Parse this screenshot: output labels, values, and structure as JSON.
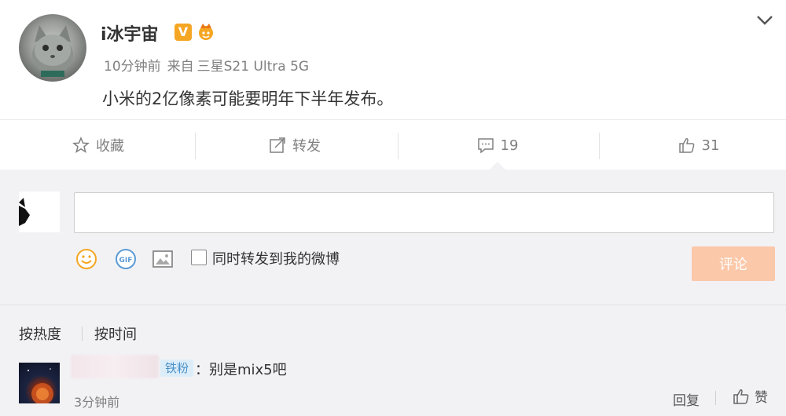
{
  "post": {
    "username": "i冰宇宙",
    "vip_badge": "V",
    "time": "10分钟前",
    "source_prefix": "来自",
    "source": "三星S21 Ultra 5G",
    "text": "小米的2亿像素可能要明年下半年发布。"
  },
  "actions": {
    "favorite_label": "收藏",
    "repost_label": "转发",
    "comment_count": "19",
    "like_count": "31"
  },
  "composer": {
    "input_value": "",
    "repost_checkbox_label": "同时转发到我的微博",
    "submit_label": "评论",
    "gif_label": "GIF"
  },
  "sort": {
    "hot_label": "按热度",
    "time_label": "按时间"
  },
  "comments": [
    {
      "badge": "铁粉",
      "text": "：别是mix5吧",
      "time": "3分钟前",
      "reply_label": "回复",
      "like_label": "赞"
    }
  ],
  "colors": {
    "accent_orange": "#fbc8a9",
    "badge_gold": "#f5a623",
    "fan_tag_bg": "#dcedf9",
    "fan_tag_text": "#4a90c8",
    "comment_bg": "#f2f2f5"
  },
  "icons": {
    "expand": "chevron-down-icon",
    "favorite": "star-icon",
    "repost": "share-icon",
    "comment": "comment-icon",
    "like": "thumbs-up-icon",
    "emoji": "smiley-icon",
    "gif": "gif-icon",
    "image": "picture-icon"
  }
}
